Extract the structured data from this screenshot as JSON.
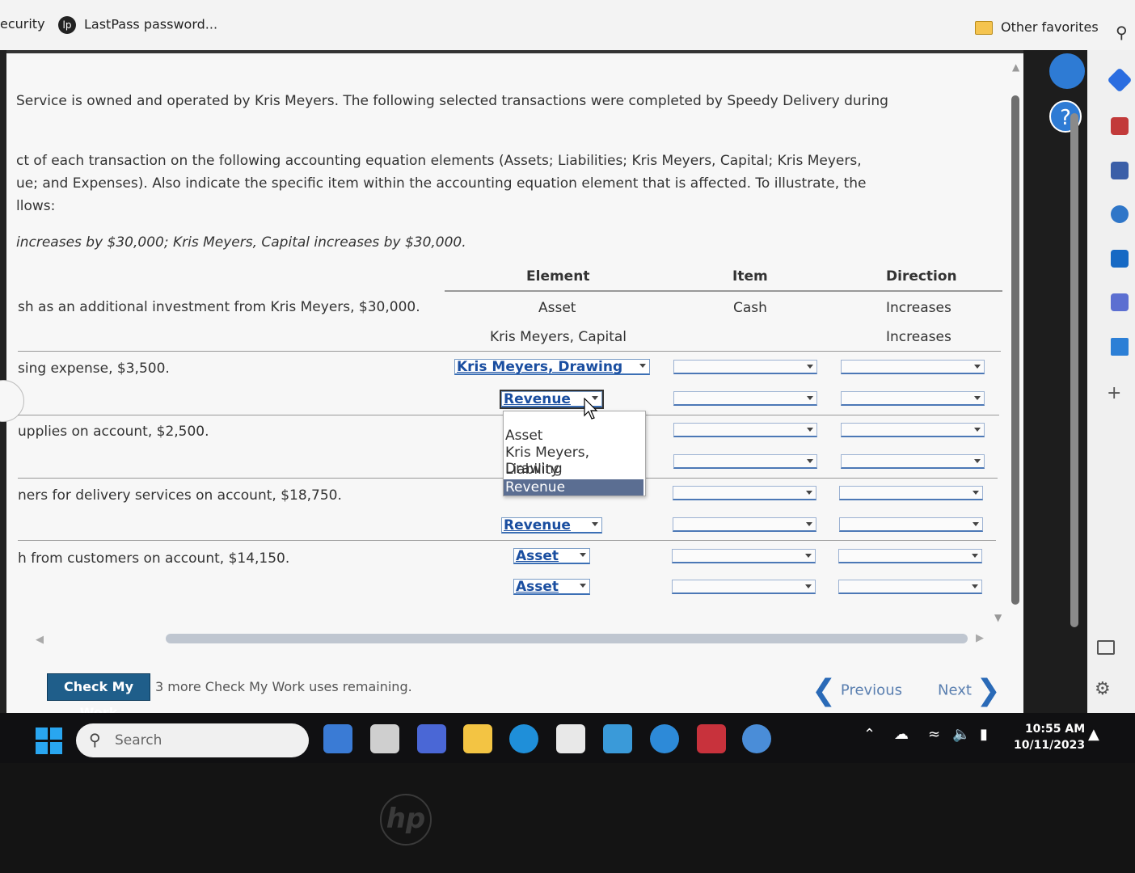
{
  "favorites_bar": {
    "security_label": "ecurity",
    "lastpass_label": "LastPass password...",
    "other_favorites": "Other favorites"
  },
  "problem": {
    "intro": "Service is owned and operated by Kris Meyers. The following selected transactions were completed by Speedy Delivery during",
    "instr_line1": "ct of each transaction on the following accounting equation elements (Assets; Liabilities; Kris Meyers, Capital; Kris Meyers,",
    "instr_line2": "ue; and Expenses). Also indicate the specific item within the accounting equation element that is affected. To illustrate, the",
    "instr_line3": "llows:",
    "example": "increases by $30,000; Kris Meyers, Capital increases by $30,000."
  },
  "table": {
    "headers": {
      "element": "Element",
      "item": "Item",
      "direction": "Direction"
    },
    "example_row": {
      "desc": "sh as an additional investment from Kris Meyers, $30,000.",
      "el1": "Asset",
      "item1": "Cash",
      "dir1": "Increases",
      "el2": "Kris Meyers, Capital",
      "dir2": "Increases"
    },
    "rows": [
      {
        "desc": "sing expense, $3,500.",
        "sel1": "Kris Meyers, Drawing",
        "sel2": "Revenue"
      },
      {
        "desc": "upplies on account, $2,500.",
        "sel1": "",
        "sel2": ""
      },
      {
        "desc": "ners for delivery services on account, $18,750.",
        "sel1": "",
        "sel2": "Revenue"
      },
      {
        "desc": "h from customers on account, $14,150.",
        "sel1": "Asset",
        "sel2": "Asset"
      }
    ]
  },
  "dropdown": {
    "options": [
      "Asset",
      "Kris Meyers, Drawing",
      "Liability",
      "Revenue"
    ],
    "highlighted": "Revenue"
  },
  "footer": {
    "check_my_work": "Check My Work",
    "remaining": "3 more Check My Work uses remaining.",
    "previous": "Previous",
    "next": "Next"
  },
  "taskbar": {
    "search_placeholder": "Search",
    "time": "10:55 AM",
    "date": "10/11/2023"
  },
  "colors": {
    "accent": "#1f5e8a",
    "link": "#1a4ea0",
    "highlight": "#5b6e92"
  }
}
